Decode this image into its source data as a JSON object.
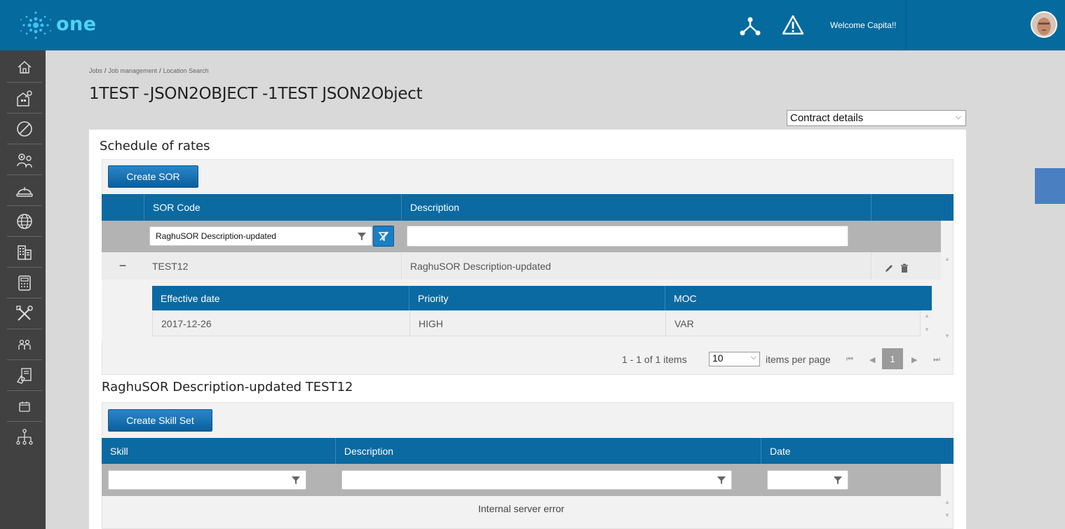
{
  "header": {
    "logo_text": "one",
    "welcome": "Welcome Capita!!",
    "icons": [
      "network-icon",
      "warning-icon"
    ]
  },
  "sidebar": {
    "items": [
      "home-icon",
      "property-icon",
      "block-icon",
      "settings-people-icon",
      "hard-hat-icon",
      "globe-icon",
      "buildings-icon",
      "calculator-icon",
      "tools-icon",
      "people-icon",
      "contract-icon",
      "calendar-icon",
      "hierarchy-icon"
    ]
  },
  "breadcrumb": [
    "Jobs",
    "Job management",
    "Location Search"
  ],
  "page_title": "1TEST -JSON2OBJECT -1TEST JSON2Object",
  "contract_select": "Contract details",
  "sor": {
    "section_title": "Schedule of rates",
    "create_button": "Create SOR",
    "columns": [
      "SOR Code",
      "Description"
    ],
    "filter_code_value": "RaghuSOR Description-updated",
    "filter_desc_value": "",
    "rows": [
      {
        "expand": "−",
        "code": "TEST12",
        "description": "RaghuSOR Description-updated"
      }
    ],
    "detail": {
      "columns": [
        "Effective date",
        "Priority",
        "MOC"
      ],
      "rows": [
        {
          "date": "2017-12-26",
          "priority": "HIGH",
          "moc": "VAR"
        }
      ]
    },
    "pager": {
      "summary": "1 - 1 of 1 items",
      "page_size": "10",
      "per_page_label": "items per page",
      "current_page": "1"
    }
  },
  "skill": {
    "section_title": "RaghuSOR Description-updated TEST12",
    "create_button": "Create Skill Set",
    "columns": [
      "Skill",
      "Description",
      "Date"
    ],
    "message": "Internal server error"
  },
  "colors": {
    "brand": "#056a9e",
    "grid_header": "#0a6aa1",
    "sidebar": "#414141"
  }
}
